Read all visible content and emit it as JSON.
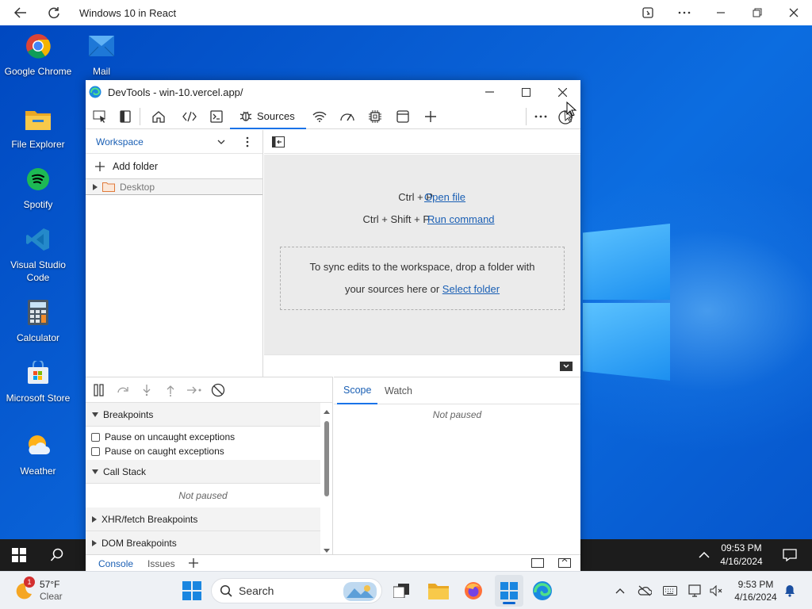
{
  "browser": {
    "title": "Windows 10 in React"
  },
  "desktop_icons": [
    {
      "label": "Google Chrome"
    },
    {
      "label": "Mail"
    },
    {
      "label": "File Explorer"
    },
    {
      "label": "Spotify"
    },
    {
      "label": "Visual Studio Code"
    },
    {
      "label": "Calculator"
    },
    {
      "label": "Microsoft Store"
    },
    {
      "label": "Weather"
    }
  ],
  "devtools": {
    "title": "DevTools - win-10.vercel.app/",
    "active_tab": "Sources",
    "navigator": {
      "dropdown": "Workspace",
      "add_folder": "Add folder",
      "tree": [
        {
          "label": "Desktop"
        }
      ]
    },
    "editor": {
      "shortcut1_keys": "Ctrl + P",
      "shortcut1_action": "Open file",
      "shortcut2_keys": "Ctrl + Shift + P",
      "shortcut2_action": "Run command",
      "drop_text_1": "To sync edits to the workspace, drop a folder with",
      "drop_text_2": "your sources here or",
      "drop_link": "Select folder"
    },
    "debugger": {
      "breakpoints_header": "Breakpoints",
      "pause_uncaught": "Pause on uncaught exceptions",
      "pause_caught": "Pause on caught exceptions",
      "callstack_header": "Call Stack",
      "callstack_status": "Not paused",
      "xhr_header": "XHR/fetch Breakpoints",
      "dom_header": "DOM Breakpoints"
    },
    "scope": {
      "tab_scope": "Scope",
      "tab_watch": "Watch",
      "status": "Not paused"
    },
    "drawer": {
      "tab_console": "Console",
      "tab_issues": "Issues"
    }
  },
  "w10_taskbar": {
    "time": "09:53 PM",
    "date": "4/16/2024"
  },
  "w11_taskbar": {
    "weather_temp": "57°F",
    "weather_desc": "Clear",
    "weather_badge": "1",
    "search_placeholder": "Search",
    "time": "9:53 PM",
    "date": "4/16/2024"
  },
  "colors": {
    "accent": "#1a73e8",
    "link": "#1a5fb4",
    "desktop": "#0a56c8"
  }
}
